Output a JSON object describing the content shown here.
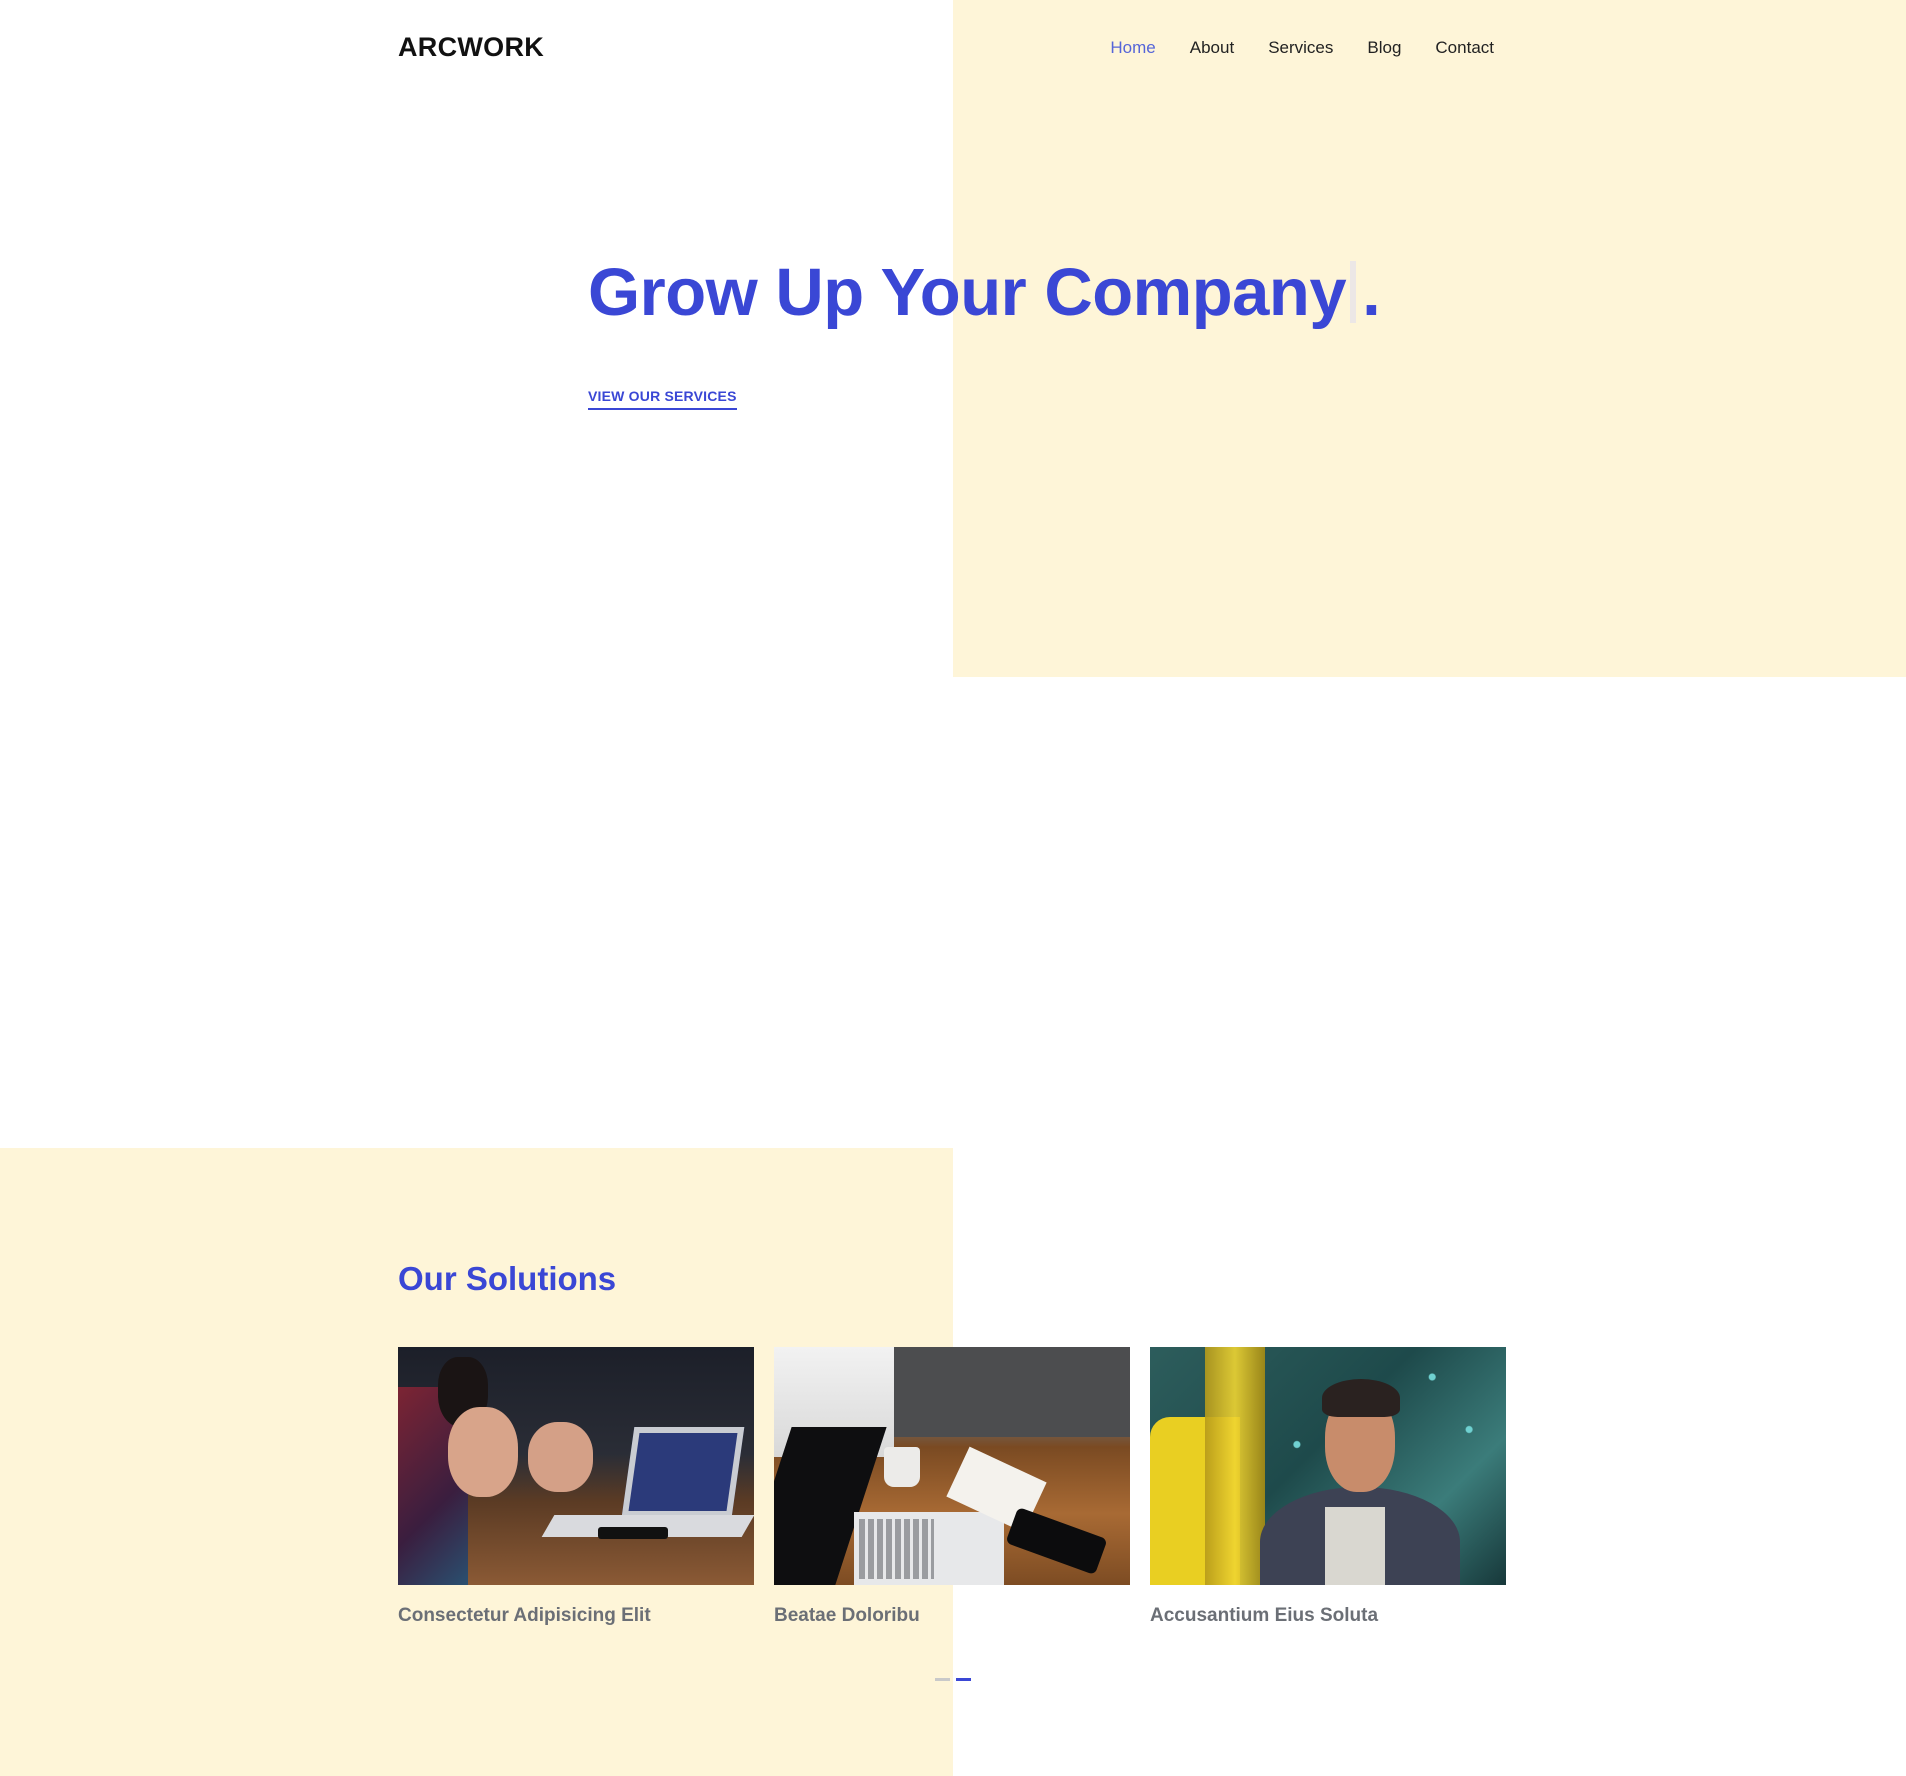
{
  "header": {
    "logo": "ARCWORK",
    "nav": [
      {
        "label": "Home",
        "active": true
      },
      {
        "label": "About",
        "active": false
      },
      {
        "label": "Services",
        "active": false
      },
      {
        "label": "Blog",
        "active": false
      },
      {
        "label": "Contact",
        "active": false
      }
    ]
  },
  "hero": {
    "title": "Grow Up Your Company",
    "title_suffix": ".",
    "cta": "VIEW OUR SERVICES"
  },
  "solutions": {
    "title": "Our Solutions",
    "cards": [
      {
        "caption": "Consectetur Adipisicing Elit",
        "image": "meeting-laptop-photo"
      },
      {
        "caption": "Beatae Doloribu",
        "image": "desk-laptop-photo"
      },
      {
        "caption": "Accusantium Eius Soluta",
        "image": "smiling-man-photo"
      }
    ],
    "pager": {
      "pages": 2,
      "current": 2
    }
  },
  "colors": {
    "accent": "#3a47d5",
    "cream": "#fef5d8",
    "nav_active": "#5565d8"
  }
}
